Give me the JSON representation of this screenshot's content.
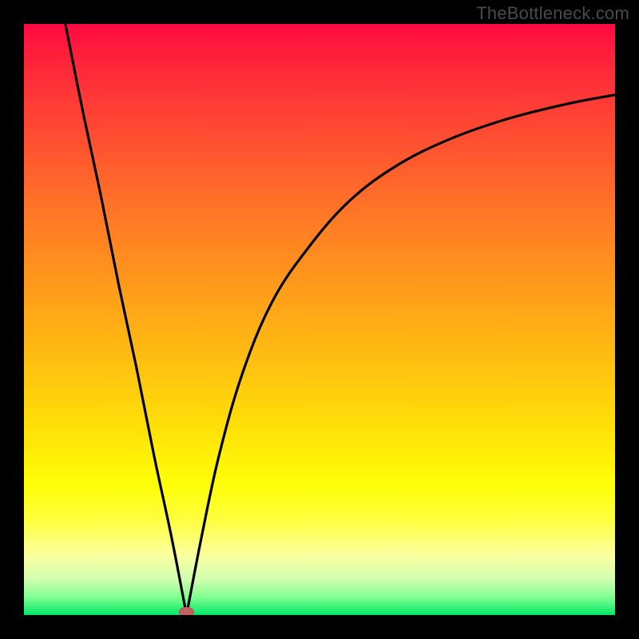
{
  "watermark": "TheBottleneck.com",
  "chart_data": {
    "type": "line",
    "title": "",
    "xlabel": "",
    "ylabel": "",
    "xlim": [
      0,
      100
    ],
    "ylim": [
      0,
      100
    ],
    "legend": false,
    "grid": false,
    "annotations": [],
    "background_gradient": {
      "top": "#ff0a40",
      "bottom": "#00e868",
      "description": "red-orange-yellow-green vertical gradient"
    },
    "series": [
      {
        "name": "left-branch",
        "x": [
          7,
          10,
          13,
          16,
          19,
          22,
          25,
          27.5
        ],
        "values": [
          100,
          85,
          71,
          56,
          42,
          27,
          13,
          0
        ]
      },
      {
        "name": "right-branch",
        "x": [
          27.5,
          30,
          33,
          37,
          42,
          48,
          55,
          63,
          72,
          82,
          92,
          100
        ],
        "values": [
          0,
          13,
          27,
          41,
          53,
          62,
          70,
          76,
          80.5,
          84,
          86.5,
          88
        ]
      }
    ],
    "marker": {
      "x": 27.5,
      "y": 0.5,
      "shape": "ellipse",
      "color": "#c06060"
    }
  }
}
